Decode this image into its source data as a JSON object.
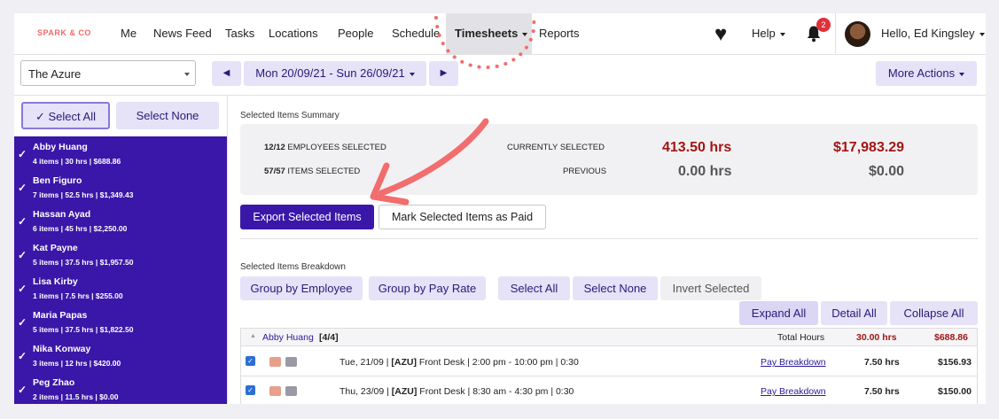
{
  "brand": {
    "logo_text": "SPARK & CO"
  },
  "nav": {
    "items": [
      {
        "label": "Me"
      },
      {
        "label": "News Feed"
      },
      {
        "label": "Tasks"
      },
      {
        "label": "Locations"
      },
      {
        "label": "People"
      },
      {
        "label": "Schedule"
      },
      {
        "label": "Timesheets"
      },
      {
        "label": "Reports"
      }
    ],
    "help": "Help",
    "notifications_count": "2",
    "greeting": "Hello, Ed Kingsley"
  },
  "filters": {
    "venue": "The Azure",
    "date_range": "Mon 20/09/21 - Sun 26/09/21",
    "more_actions": "More Actions"
  },
  "sidebar": {
    "select_all": "Select All",
    "select_none": "Select None",
    "employees": [
      {
        "name": "Abby Huang",
        "stats": "4 items | 30 hrs | $688.86"
      },
      {
        "name": "Ben Figuro",
        "stats": "7 items | 52.5 hrs | $1,349.43"
      },
      {
        "name": "Hassan Ayad",
        "stats": "6 items | 45 hrs | $2,250.00"
      },
      {
        "name": "Kat Payne",
        "stats": "5 items | 37.5 hrs | $1,957.50"
      },
      {
        "name": "Lisa Kirby",
        "stats": "1 items | 7.5 hrs | $255.00"
      },
      {
        "name": "Maria Papas",
        "stats": "5 items | 37.5 hrs | $1,822.50"
      },
      {
        "name": "Nika Konway",
        "stats": "3 items | 12 hrs | $420.00"
      },
      {
        "name": "Peg Zhao",
        "stats": "2 items | 11.5 hrs | $0.00"
      }
    ]
  },
  "summary": {
    "heading": "Selected Items Summary",
    "employees_selected": "12/12",
    "employees_selected_label": "EMPLOYEES SELECTED",
    "items_selected": "57/57",
    "items_selected_label": "ITEMS SELECTED",
    "currently_selected_label": "CURRENTLY SELECTED",
    "previous_label": "PREVIOUS",
    "current_hours": "413.50 hrs",
    "current_cost": "$17,983.29",
    "previous_hours": "0.00 hrs",
    "previous_cost": "$0.00"
  },
  "actions": {
    "export": "Export Selected Items",
    "mark_paid": "Mark Selected Items as Paid"
  },
  "breakdown": {
    "heading": "Selected Items Breakdown",
    "group_employee": "Group by Employee",
    "group_payrate": "Group by Pay Rate",
    "select_all": "Select All",
    "select_none": "Select None",
    "invert": "Invert Selected",
    "expand_all": "Expand All",
    "detail_all": "Detail All",
    "collapse_all": "Collapse All",
    "group": {
      "name": "Abby Huang",
      "count": "[4/4]",
      "total_label": "Total Hours",
      "total_hours": "30.00 hrs",
      "total_cost": "$688.86"
    },
    "rows": [
      {
        "date": "Tue, 21/09 |",
        "code": "[AZU]",
        "detail": "Front Desk | 2:00 pm - 10:00 pm | 0:30",
        "link": "Pay Breakdown",
        "hours": "7.50 hrs",
        "cost": "$156.93"
      },
      {
        "date": "Thu, 23/09 |",
        "code": "[AZU]",
        "detail": "Front Desk | 8:30 am - 4:30 pm | 0:30",
        "link": "Pay Breakdown",
        "hours": "7.50 hrs",
        "cost": "$150.00"
      }
    ]
  },
  "colors": {
    "accent": "#3a17a8",
    "accent_light": "#e6e2f7",
    "annotation": "#f26d6d",
    "current_red": "#a31515"
  }
}
